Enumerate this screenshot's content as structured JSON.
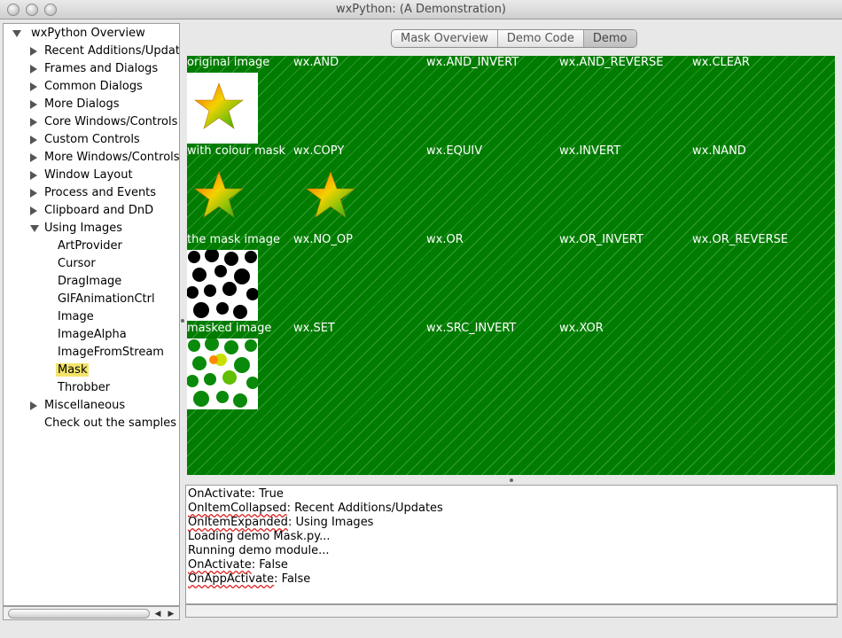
{
  "window": {
    "title": "wxPython: (A Demonstration)"
  },
  "tree": {
    "root": "wxPython Overview",
    "categories": [
      "Recent Additions/Updates",
      "Frames and Dialogs",
      "Common Dialogs",
      "More Dialogs",
      "Core Windows/Controls",
      "Custom Controls",
      "More Windows/Controls",
      "Window Layout",
      "Process and Events",
      "Clipboard and DnD",
      "Using Images"
    ],
    "using_images_children": [
      "ArtProvider",
      "Cursor",
      "DragImage",
      "GIFAnimationCtrl",
      "Image",
      "ImageAlpha",
      "ImageFromStream",
      "Mask",
      "Throbber"
    ],
    "after": [
      "Miscellaneous",
      "Check out the samples dir too"
    ],
    "selected": "Mask"
  },
  "tabs": [
    "Mask Overview",
    "Demo Code",
    "Demo"
  ],
  "active_tab": "Demo",
  "demo": {
    "row_labels": [
      "original image",
      "with colour mask",
      "the mask image",
      "masked image"
    ],
    "ops": [
      [
        "wx.AND",
        "wx.AND_INVERT",
        "wx.AND_REVERSE",
        "wx.CLEAR"
      ],
      [
        "wx.COPY",
        "wx.EQUIV",
        "wx.INVERT",
        "wx.NAND"
      ],
      [
        "wx.NO_OP",
        "wx.OR",
        "wx.OR_INVERT",
        "wx.OR_REVERSE"
      ],
      [
        "wx.SET",
        "wx.SRC_INVERT",
        "wx.XOR"
      ]
    ],
    "background_color": "#007c00"
  },
  "log": [
    {
      "prefix": "OnActivate",
      "rest": ": True",
      "squiggle": false
    },
    {
      "prefix": "OnItemCollapsed",
      "rest": ": Recent Additions/Updates",
      "squiggle": true
    },
    {
      "prefix": "OnItemExpanded",
      "rest": ": Using Images",
      "squiggle": true
    },
    {
      "prefix": "Loading demo Mask.py...",
      "rest": "",
      "squiggle": false
    },
    {
      "prefix": "Running demo module...",
      "rest": "",
      "squiggle": false
    },
    {
      "prefix": "OnActivate",
      "rest": ": False",
      "squiggle": true
    },
    {
      "prefix": "OnAppActivate",
      "rest": ": False",
      "squiggle": true
    }
  ]
}
